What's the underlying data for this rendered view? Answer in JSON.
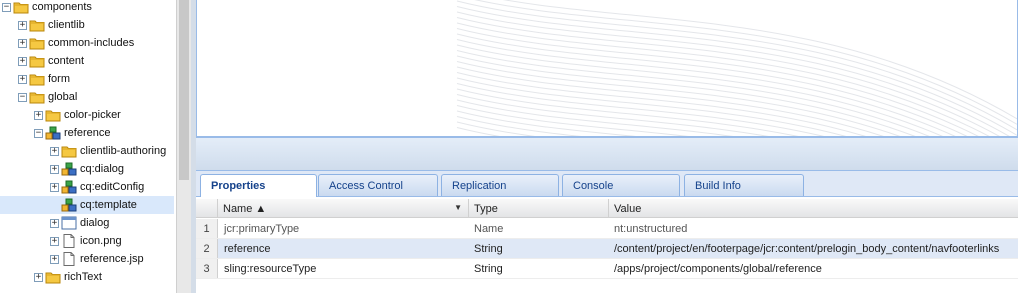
{
  "tree": {
    "items": [
      {
        "label": "components",
        "toggle": "−",
        "icon": "folder-icon",
        "depth": 0
      },
      {
        "label": "clientlib",
        "toggle": "+",
        "icon": "folder-icon",
        "depth": 1
      },
      {
        "label": "common-includes",
        "toggle": "+",
        "icon": "folder-icon",
        "depth": 1
      },
      {
        "label": "content",
        "toggle": "+",
        "icon": "folder-icon",
        "depth": 1
      },
      {
        "label": "form",
        "toggle": "+",
        "icon": "folder-icon",
        "depth": 1
      },
      {
        "label": "global",
        "toggle": "−",
        "icon": "folder-icon",
        "depth": 1
      },
      {
        "label": "color-picker",
        "toggle": "+",
        "icon": "folder-icon",
        "depth": 2
      },
      {
        "label": "reference",
        "toggle": "−",
        "icon": "component-icon",
        "depth": 2
      },
      {
        "label": "clientlib-authoring",
        "toggle": "+",
        "icon": "folder-icon",
        "depth": 3
      },
      {
        "label": "cq:dialog",
        "toggle": "+",
        "icon": "component-icon",
        "depth": 3
      },
      {
        "label": "cq:editConfig",
        "toggle": "+",
        "icon": "component-icon",
        "depth": 3
      },
      {
        "label": "cq:template",
        "toggle": "",
        "icon": "component-icon",
        "depth": 3,
        "selected": true
      },
      {
        "label": "dialog",
        "toggle": "+",
        "icon": "dialog-icon",
        "depth": 3
      },
      {
        "label": "icon.png",
        "toggle": "+",
        "icon": "file-icon",
        "depth": 3
      },
      {
        "label": "reference.jsp",
        "toggle": "+",
        "icon": "file-icon",
        "depth": 3
      },
      {
        "label": "richText",
        "toggle": "+",
        "icon": "folder-icon",
        "depth": 2
      }
    ]
  },
  "tabs": [
    {
      "label": "Properties",
      "active": true
    },
    {
      "label": "Access Control"
    },
    {
      "label": "Replication"
    },
    {
      "label": "Console"
    },
    {
      "label": "Build Info"
    }
  ],
  "grid": {
    "columns": [
      "Name ▲",
      "Type",
      "Value"
    ],
    "rows": [
      {
        "num": "1",
        "name": "jcr:primaryType",
        "type": "Name",
        "value": "nt:unstructured",
        "muted": true
      },
      {
        "num": "2",
        "name": "reference",
        "type": "String",
        "value": "/content/project/en/footerpage/jcr:content/prelogin_body_content/navfooterlinks",
        "selected": true
      },
      {
        "num": "3",
        "name": "sling:resourceType",
        "type": "String",
        "value": "/apps/project/components/global/reference"
      }
    ]
  },
  "colors": {
    "accent": "#99bbe8",
    "tab_text": "#15428b",
    "folder": "#f5c842",
    "selection": "#d9e8fb"
  }
}
